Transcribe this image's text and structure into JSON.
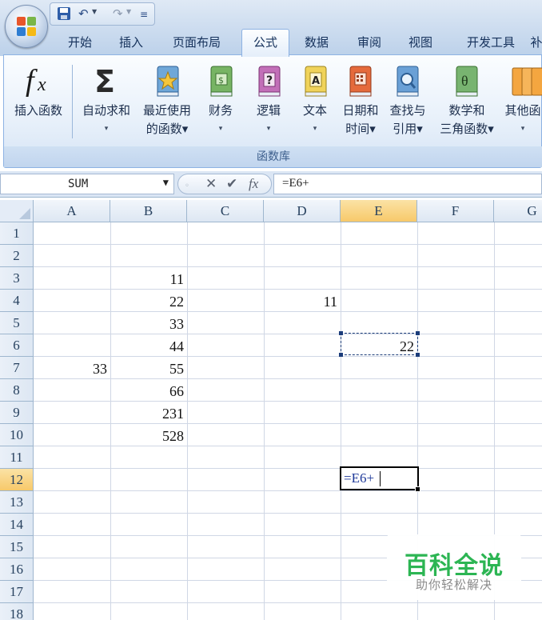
{
  "app": {
    "quick_access": {
      "save_icon": "save-icon",
      "undo_icon": "undo-icon",
      "redo_icon": "redo-icon"
    }
  },
  "tabs": [
    "开始",
    "插入",
    "页面布局",
    "公式",
    "数据",
    "审阅",
    "视图",
    "开发工具",
    "补"
  ],
  "active_tab": "公式",
  "ribbon": {
    "group_label": "函数库",
    "buttons": [
      {
        "line1": "插入函数",
        "line2": "",
        "icon": "fx-icon"
      },
      {
        "line1": "自动求和",
        "line2": "▾",
        "icon": "sigma-icon"
      },
      {
        "line1": "最近使用",
        "line2": "的函数▾",
        "icon": "recent-book-icon"
      },
      {
        "line1": "财务",
        "line2": "▾",
        "icon": "finance-book-icon"
      },
      {
        "line1": "逻辑",
        "line2": "▾",
        "icon": "logic-book-icon"
      },
      {
        "line1": "文本",
        "line2": "▾",
        "icon": "text-book-icon"
      },
      {
        "line1": "日期和",
        "line2": "时间▾",
        "icon": "datetime-book-icon"
      },
      {
        "line1": "查找与",
        "line2": "引用▾",
        "icon": "lookup-book-icon"
      },
      {
        "line1": "数学和",
        "line2": "三角函数▾",
        "icon": "math-book-icon"
      },
      {
        "line1": "其他函",
        "line2": "▾",
        "icon": "more-books-icon"
      }
    ]
  },
  "formula_bar": {
    "name_box": "SUM",
    "formula": "=E6+"
  },
  "sheet": {
    "columns": [
      "A",
      "B",
      "C",
      "D",
      "E",
      "F",
      "G"
    ],
    "rows": [
      "1",
      "2",
      "3",
      "4",
      "5",
      "6",
      "7",
      "8",
      "9",
      "10",
      "11",
      "12",
      "13",
      "14",
      "15",
      "16",
      "17",
      "18"
    ],
    "selected_column": "E",
    "selected_row": "12",
    "cells": {
      "B3": "11",
      "B4": "22",
      "B5": "33",
      "B6": "44",
      "A7": "33",
      "B7": "55",
      "B8": "66",
      "B9": "231",
      "B10": "528",
      "D4": "11",
      "E6": "22"
    },
    "editing_cell": {
      "ref": "E12",
      "text": "=E6+"
    }
  },
  "watermark": {
    "title": "百科全说",
    "subtitle": "助你轻松解决"
  }
}
